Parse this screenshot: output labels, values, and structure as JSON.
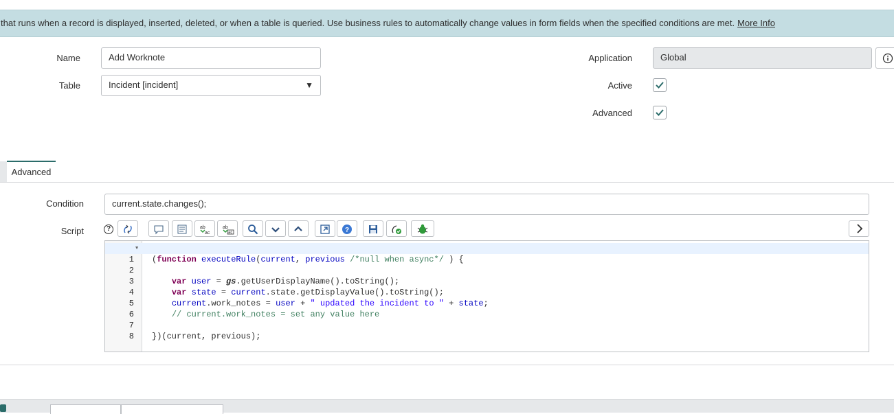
{
  "info_bar": {
    "text": "ver-side script that runs when a record is displayed, inserted, deleted, or when a table is queried. Use business rules to automatically change values in form fields when the specified conditions are met.",
    "link": "More Info"
  },
  "form": {
    "name_label": "Name",
    "name_value": "Add Worknote",
    "table_label": "Table",
    "table_value": "Incident [incident]",
    "application_label": "Application",
    "application_value": "Global",
    "active_label": "Active",
    "advanced_label": "Advanced"
  },
  "tabs": {
    "advanced": "Advanced"
  },
  "condition": {
    "label": "Condition",
    "value": "current.state.changes();"
  },
  "script": {
    "label": "Script",
    "help": "?",
    "line_numbers": [
      "1",
      "2",
      "3",
      "4",
      "5",
      "6",
      "7",
      "8"
    ]
  },
  "icons": {
    "toolbar": [
      "format-code-icon",
      "toggle-comment-icon",
      "format-icon",
      "replace-icon",
      "replace-all-icon",
      "search-icon",
      "find-next-icon",
      "find-previous-icon",
      "fullscreen-icon",
      "help-icon",
      "save-icon",
      "syntax-check-icon",
      "debug-icon"
    ]
  },
  "colors": {
    "info_bar": "#c4dde2",
    "check": "#2b6c6a",
    "tab_accent": "#2b6c6a"
  }
}
